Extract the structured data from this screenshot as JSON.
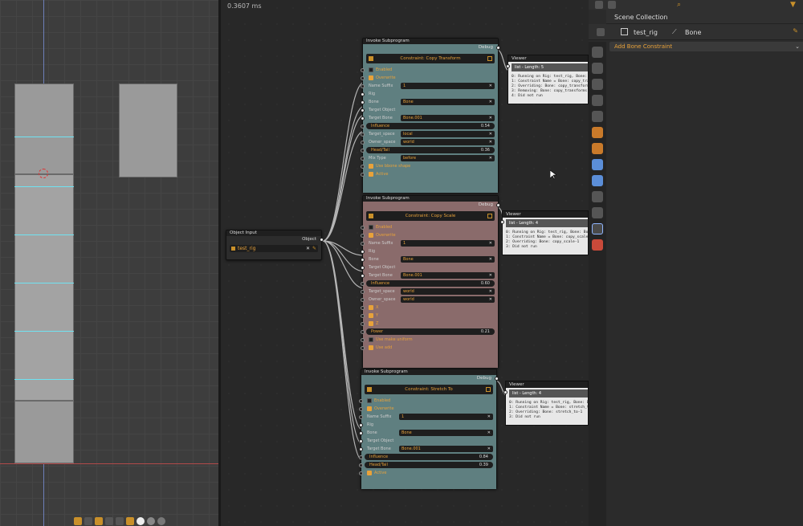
{
  "viewport": {},
  "node_editor": {
    "timing": "0.3607 ms",
    "object_input": {
      "header": "Object Input",
      "socket_label": "Object",
      "value": "test_rig"
    },
    "invoke_nodes": [
      {
        "header": "Invoke Subprogram",
        "debug_label": "Debug",
        "title": "Constraint: Copy Transform",
        "fields": [
          {
            "type": "check",
            "label": "Enabled",
            "checked": false
          },
          {
            "type": "check",
            "label": "Overwrite",
            "checked": true
          },
          {
            "type": "text",
            "label": "Name Suffix",
            "value": "1"
          },
          {
            "type": "plain",
            "label": "Rig"
          },
          {
            "type": "text",
            "label": "Bone",
            "value": "Bone"
          },
          {
            "type": "plain",
            "label": "Target Object"
          },
          {
            "type": "text",
            "label": "Target Bone",
            "value": "Bone.001"
          },
          {
            "type": "slider",
            "label": "Influence",
            "value": "0.54"
          },
          {
            "type": "text",
            "label": "Target_space",
            "value": "local"
          },
          {
            "type": "text",
            "label": "Owner_space",
            "value": "world"
          },
          {
            "type": "slider",
            "label": "Head/Tail",
            "value": "0.36"
          },
          {
            "type": "text",
            "label": "Mix Type",
            "value": "before"
          },
          {
            "type": "check",
            "label": "Use bbone shape",
            "checked": true
          },
          {
            "type": "check",
            "label": "Active",
            "checked": true
          }
        ]
      },
      {
        "header": "Invoke Subprogram",
        "debug_label": "Debug",
        "title": "Constraint: Copy Scale",
        "fields": [
          {
            "type": "check",
            "label": "Enabled",
            "checked": false
          },
          {
            "type": "check",
            "label": "Overwrite",
            "checked": true
          },
          {
            "type": "text",
            "label": "Name Suffix",
            "value": "1"
          },
          {
            "type": "plain",
            "label": "Rig"
          },
          {
            "type": "text",
            "label": "Bone",
            "value": "Bone"
          },
          {
            "type": "plain",
            "label": "Target Object"
          },
          {
            "type": "text",
            "label": "Target Bone",
            "value": "Bone.001"
          },
          {
            "type": "slider",
            "label": "Influence",
            "value": "0.60"
          },
          {
            "type": "text",
            "label": "Target_space",
            "value": "world"
          },
          {
            "type": "text",
            "label": "Owner_space",
            "value": "world"
          },
          {
            "type": "check",
            "label": "X",
            "checked": true
          },
          {
            "type": "check",
            "label": "Y",
            "checked": true
          },
          {
            "type": "check",
            "label": "Z",
            "checked": true
          },
          {
            "type": "slider",
            "label": "Power",
            "value": "0.21"
          },
          {
            "type": "check",
            "label": "Use make uniform",
            "checked": false
          },
          {
            "type": "check",
            "label": "Use add",
            "checked": true
          }
        ]
      },
      {
        "header": "Invoke Subprogram",
        "debug_label": "Debug",
        "title": "Constraint: Stretch To",
        "fields": [
          {
            "type": "check",
            "label": "Enabled",
            "checked": false
          },
          {
            "type": "check",
            "label": "Overwrite",
            "checked": true
          },
          {
            "type": "text",
            "label": "Name Suffix",
            "value": "1"
          },
          {
            "type": "plain",
            "label": "Rig"
          },
          {
            "type": "text",
            "label": "Bone",
            "value": "Bone"
          },
          {
            "type": "plain",
            "label": "Target Object"
          },
          {
            "type": "text",
            "label": "Target Bone",
            "value": "Bone.001"
          },
          {
            "type": "slider",
            "label": "Influence",
            "value": "0.84"
          },
          {
            "type": "slider",
            "label": "Head/Tail",
            "value": "0.39"
          },
          {
            "type": "check",
            "label": "Active",
            "checked": true
          }
        ]
      }
    ],
    "viewers": [
      {
        "header": "Viewer",
        "bar": "list - Length: 5",
        "lines": [
          "0: Running on Rig: test_rig, Bone: Bone",
          "1: Constraint Name = Bone: copy_transforms",
          "2: Overriding: Bone: copy_transforms",
          "3: Removing: Bone: copy_transforms",
          "4: Did not run"
        ]
      },
      {
        "header": "Viewer",
        "bar": "list - Length: 4",
        "lines": [
          "0: Running on Rig: test_rig, Bone: Bone",
          "1: Constraint Name = Bone: copy_scale-1",
          "2: Overriding: Bone: copy_scale-1",
          "3: Did not run"
        ]
      },
      {
        "header": "Viewer",
        "bar": "list - Length: 4",
        "lines": [
          "0: Running on Rig: test_rig, Bone: Bone",
          "1: Constraint Name = Bone: stretch_to-1",
          "2: Overriding: Bone: stretch_to-1",
          "3: Did not run"
        ]
      }
    ]
  },
  "properties": {
    "outliner_label": "Scene Collection",
    "object_name": "test_rig",
    "bone_name": "Bone",
    "add_button": "Add Bone Constraint"
  }
}
